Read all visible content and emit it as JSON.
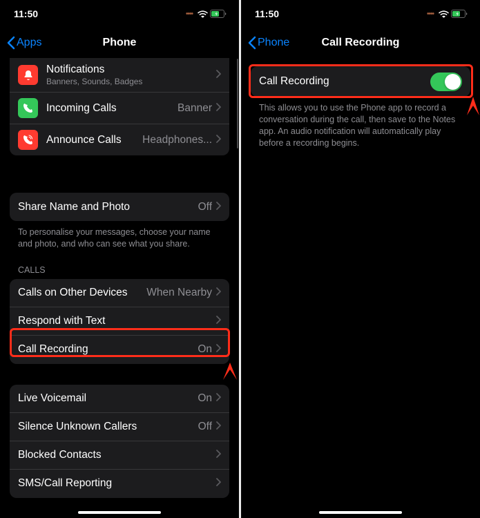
{
  "status": {
    "time": "11:50"
  },
  "left": {
    "back_label": "Apps",
    "title": "Phone",
    "rows": {
      "notifications": {
        "label": "Notifications",
        "sub": "Banners, Sounds, Badges"
      },
      "incoming": {
        "label": "Incoming Calls",
        "value": "Banner"
      },
      "announce": {
        "label": "Announce Calls",
        "value": "Headphones..."
      },
      "share": {
        "label": "Share Name and Photo",
        "value": "Off"
      },
      "share_footer": "To personalise your messages, choose your name and photo, and who can see what you share.",
      "calls_header": "CALLS",
      "other_devices": {
        "label": "Calls on Other Devices",
        "value": "When Nearby"
      },
      "respond": {
        "label": "Respond with Text"
      },
      "recording": {
        "label": "Call Recording",
        "value": "On"
      },
      "voicemail": {
        "label": "Live Voicemail",
        "value": "On"
      },
      "silence": {
        "label": "Silence Unknown Callers",
        "value": "Off"
      },
      "blocked": {
        "label": "Blocked Contacts"
      },
      "sms": {
        "label": "SMS/Call Reporting"
      }
    }
  },
  "right": {
    "back_label": "Phone",
    "title": "Call Recording",
    "toggle_label": "Call Recording",
    "description": "This allows you to use the Phone app to record a conversation during the call, then save to the Notes app. An audio notification will automatically play before a recording begins."
  }
}
